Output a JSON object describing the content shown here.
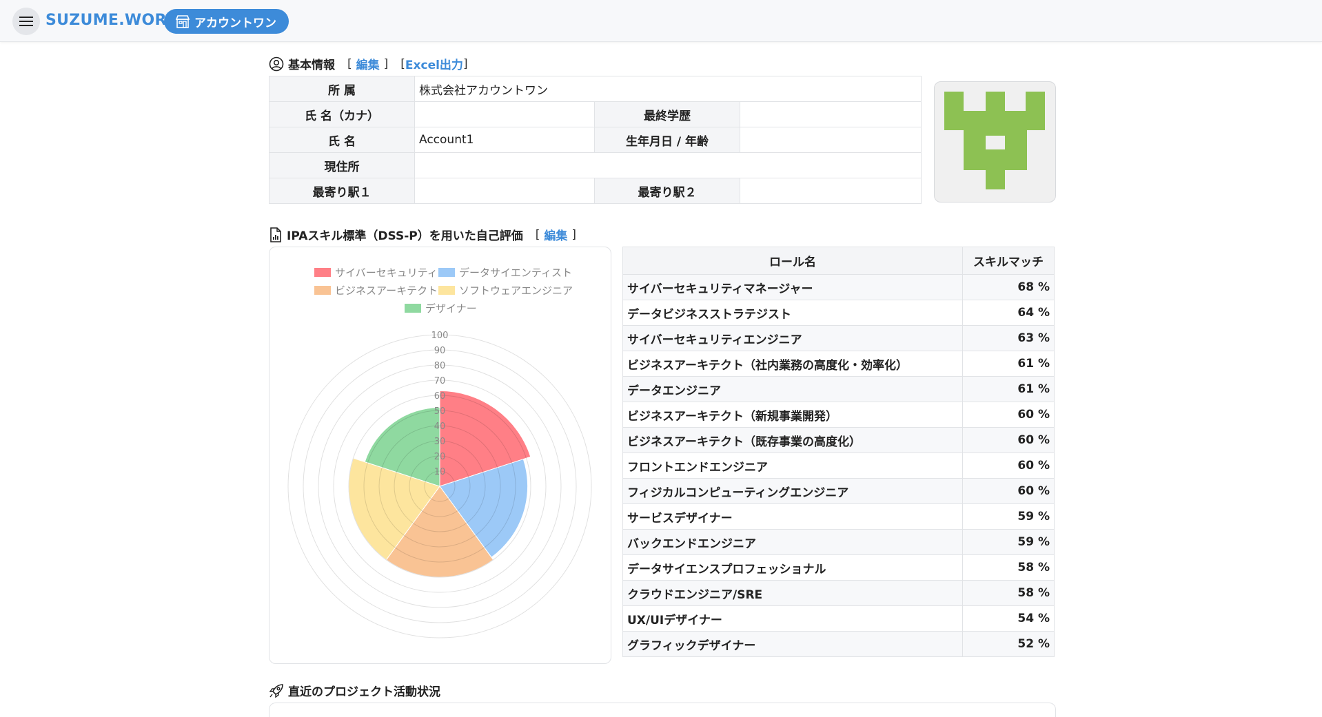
{
  "header": {
    "brand": "SUZUME.WORK",
    "company_pill": "アカウントワン"
  },
  "basic_info": {
    "title": "基本情報",
    "edit_link": "編集",
    "excel_link": "Excel出力",
    "rows": {
      "affiliation_label": "所 属",
      "affiliation_value": "株式会社アカウントワン",
      "kana_label": "氏 名（カナ）",
      "kana_value": "",
      "education_label": "最終学歴",
      "education_value": "",
      "name_label": "氏 名",
      "name_value": "Account1",
      "birth_label": "生年月日 / 年齢",
      "birth_value": "",
      "address_label": "現住所",
      "address_value": "",
      "station1_label": "最寄り駅１",
      "station1_value": "",
      "station2_label": "最寄り駅２",
      "station2_value": ""
    }
  },
  "skill_section": {
    "title": "IPAスキル標準（DSS-P）を用いた自己評価",
    "edit_link": "編集"
  },
  "colors": {
    "accent": "#3d8bd9",
    "logo_green": "#8dc153"
  },
  "chart_data": {
    "type": "polarArea",
    "categories": [
      "サイバーセキュリティ",
      "データサイエンティスト",
      "ビジネスアーキテクト",
      "ソフトウェアエンジニア",
      "デザイナー"
    ],
    "values": [
      63,
      58,
      60,
      60,
      52
    ],
    "colors": [
      "#ff7f86",
      "#9cc9f7",
      "#f9c394",
      "#fde59e",
      "#8fd9a0"
    ],
    "rlim": [
      0,
      100
    ],
    "ticks": [
      "10",
      "20",
      "30",
      "40",
      "50",
      "60",
      "70",
      "80",
      "90",
      "100"
    ],
    "legend_position": "top"
  },
  "skill_table": {
    "col_role": "ロール名",
    "col_match": "スキルマッチ",
    "rows": [
      {
        "role": "サイバーセキュリティマネージャー",
        "pct": "68 %"
      },
      {
        "role": "データビジネスストラテジスト",
        "pct": "64 %"
      },
      {
        "role": "サイバーセキュリティエンジニア",
        "pct": "63 %"
      },
      {
        "role": "ビジネスアーキテクト（社内業務の高度化・効率化）",
        "pct": "61 %"
      },
      {
        "role": "データエンジニア",
        "pct": "61 %"
      },
      {
        "role": "ビジネスアーキテクト（新規事業開発）",
        "pct": "60 %"
      },
      {
        "role": "ビジネスアーキテクト（既存事業の高度化）",
        "pct": "60 %"
      },
      {
        "role": "フロントエンドエンジニア",
        "pct": "60 %"
      },
      {
        "role": "フィジカルコンピューティングエンジニア",
        "pct": "60 %"
      },
      {
        "role": "サービスデザイナー",
        "pct": "59 %"
      },
      {
        "role": "バックエンドエンジニア",
        "pct": "59 %"
      },
      {
        "role": "データサイエンスプロフェッショナル",
        "pct": "58 %"
      },
      {
        "role": "クラウドエンジニア/SRE",
        "pct": "58 %"
      },
      {
        "role": "UX/UIデザイナー",
        "pct": "54 %"
      },
      {
        "role": "グラフィックデザイナー",
        "pct": "52 %"
      }
    ]
  },
  "project_section": {
    "title": "直近のプロジェクト活動状況"
  }
}
